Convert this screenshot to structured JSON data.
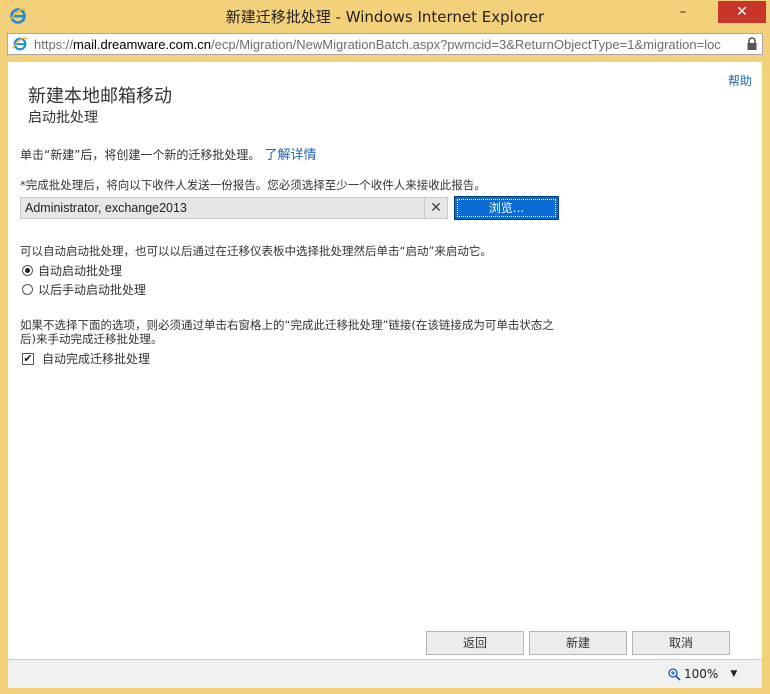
{
  "window": {
    "title": "新建迁移批处理 - Windows Internet Explorer",
    "buttons": {
      "minimize": "–",
      "maximize": "□",
      "close": "✕"
    }
  },
  "address_bar": {
    "url_prefix": "https://",
    "url_domain": "mail.dreamware.com.cn",
    "url_path": "/ecp/Migration/NewMigrationBatch.aspx?pwmcid=3&ReturnObjectType=1&migration=loc"
  },
  "page": {
    "help_link": "帮助",
    "title": "新建本地邮箱移动",
    "subtitle": "启动批处理",
    "intro_text": "单击“新建”后，将创建一个新的迁移批处理。",
    "intro_link": "了解详情",
    "report_note": "*完成批处理后，将向以下收件人发送一份报告。您必须选择至少一个收件人来接收此报告。",
    "recipients_value": "Administrator, exchange2013",
    "clear_glyph": "✕",
    "browse_button": "浏览...",
    "start_note": "可以自动启动批处理，也可以以后通过在迁移仪表板中选择批处理然后单击“启动”来启动它。",
    "start_options": [
      {
        "label": "自动启动批处理",
        "selected": true
      },
      {
        "label": "以后手动启动批处理",
        "selected": false
      }
    ],
    "complete_note": "如果不选择下面的选项，则必须通过单击右窗格上的“完成此迁移批处理”链接(在该链接成为可单击状态之后)来手动完成迁移批处理。",
    "auto_complete_label": "自动完成迁移批处理",
    "auto_complete_checked": true,
    "check_glyph": "✔"
  },
  "footer": {
    "back_button": "返回",
    "new_button": "新建",
    "cancel_button": "取消"
  },
  "status_bar": {
    "zoom_level": "100%",
    "chevron": "▼"
  }
}
